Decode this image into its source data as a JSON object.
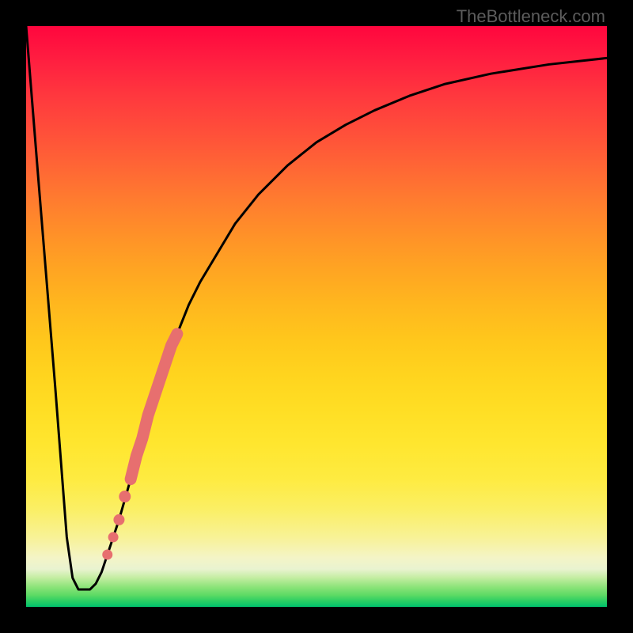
{
  "watermark_text": "TheBottleneck.com",
  "colors": {
    "frame": "#000000",
    "curve_stroke": "#000000",
    "marker_fill": "#e76f6f",
    "watermark": "#5c5c5c"
  },
  "chart_data": {
    "type": "line",
    "title": "",
    "xlabel": "",
    "ylabel": "",
    "xlim": [
      0,
      100
    ],
    "ylim": [
      0,
      100
    ],
    "grid": false,
    "notes": "Vertical gradient encodes bottleneck severity: red=high, green=minimal. Black curve is bottleneck % vs matching index. Pink markers highlight a region on the rising limb.",
    "series": [
      {
        "name": "bottleneck-curve",
        "x": [
          0,
          2,
          5,
          7,
          8,
          9,
          10,
          11,
          12,
          13,
          14,
          16,
          18,
          20,
          22,
          24,
          26,
          28,
          30,
          33,
          36,
          40,
          45,
          50,
          55,
          60,
          66,
          72,
          80,
          90,
          100
        ],
        "y": [
          100,
          75,
          38,
          12,
          5,
          3,
          3,
          3,
          4,
          6,
          9,
          15,
          22,
          29,
          36,
          42,
          47,
          52,
          56,
          61,
          66,
          71,
          76,
          80,
          83,
          85.5,
          88,
          90,
          91.8,
          93.4,
          94.5
        ]
      },
      {
        "name": "highlight-markers",
        "x": [
          14,
          15,
          16,
          17,
          18,
          19,
          20,
          21,
          22,
          23,
          24,
          25,
          26
        ],
        "y": [
          9,
          12,
          15,
          19,
          22,
          26,
          29,
          33,
          36,
          39,
          42,
          45,
          47
        ]
      }
    ]
  }
}
